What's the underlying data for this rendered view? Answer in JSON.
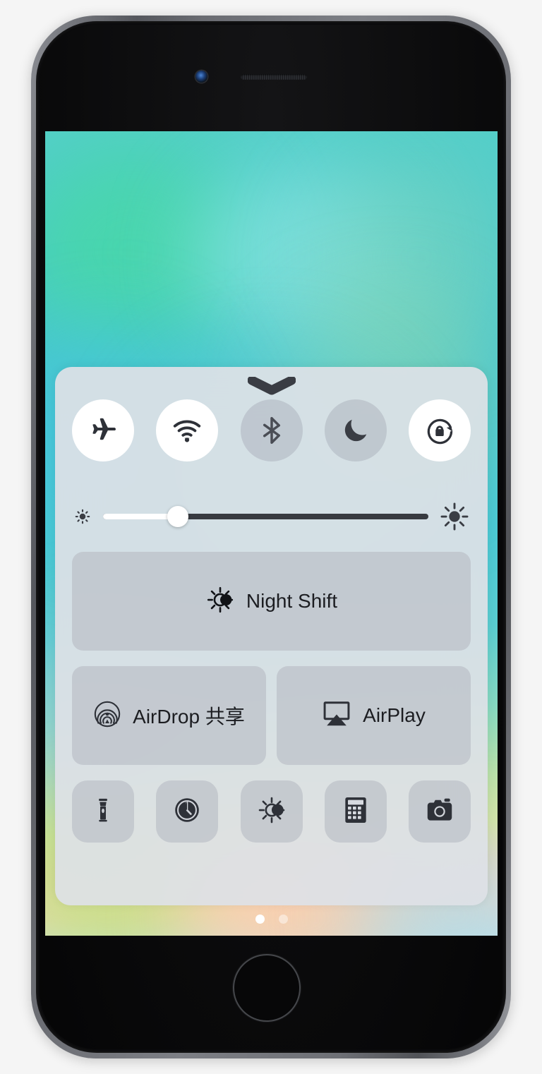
{
  "device": {
    "name": "iPhone",
    "color_finish": "space-gray",
    "front_camera": "front-camera",
    "earpiece": "earpiece-speaker",
    "home_button": "home-button",
    "side_buttons": [
      "mute-switch",
      "volume-up",
      "volume-down",
      "power-button"
    ]
  },
  "screen": {
    "wallpaper_colors": {
      "top": "#54cfc9",
      "mid": "#45c5d2",
      "bottom_left": "#bee278",
      "bottom_center": "#face aa",
      "bottom_right": "#b0d8e4"
    }
  },
  "control_center": {
    "grabber_icon": "chevron-down-icon",
    "panel_color": "#dee1e6",
    "card_color": "#bcc0c8",
    "icon_color": "#2e3138",
    "toggles": [
      {
        "id": "airplane-mode",
        "icon": "airplane-icon",
        "label": "Airplane Mode",
        "state": "on"
      },
      {
        "id": "wifi",
        "icon": "wifi-icon",
        "label": "Wi-Fi",
        "state": "on"
      },
      {
        "id": "bluetooth",
        "icon": "bluetooth-icon",
        "label": "Bluetooth",
        "state": "off"
      },
      {
        "id": "do-not-disturb",
        "icon": "moon-icon",
        "label": "Do Not Disturb",
        "state": "off"
      },
      {
        "id": "rotation-lock",
        "icon": "rotation-lock-icon",
        "label": "Rotation Lock",
        "state": "on"
      }
    ],
    "brightness": {
      "name": "brightness-slider",
      "min_icon": "sun-small-icon",
      "max_icon": "sun-large-icon",
      "value_percent": 23
    },
    "night_shift": {
      "label": "Night Shift",
      "icon": "night-shift-icon",
      "state": "off"
    },
    "share_cards": [
      {
        "id": "airdrop",
        "label": "AirDrop 共享",
        "icon": "airdrop-icon"
      },
      {
        "id": "airplay",
        "label": "AirPlay",
        "icon": "airplay-icon"
      }
    ],
    "shortcuts": [
      {
        "id": "flashlight",
        "icon": "flashlight-icon",
        "label": "Flashlight"
      },
      {
        "id": "timer",
        "icon": "timer-icon",
        "label": "Timer"
      },
      {
        "id": "night-shift-shortcut",
        "icon": "sun-moon-icon",
        "label": "Night Shift"
      },
      {
        "id": "calculator",
        "icon": "calculator-icon",
        "label": "Calculator"
      },
      {
        "id": "camera",
        "icon": "camera-icon",
        "label": "Camera"
      }
    ],
    "page_dots": {
      "total": 2,
      "active_index": 0
    }
  }
}
